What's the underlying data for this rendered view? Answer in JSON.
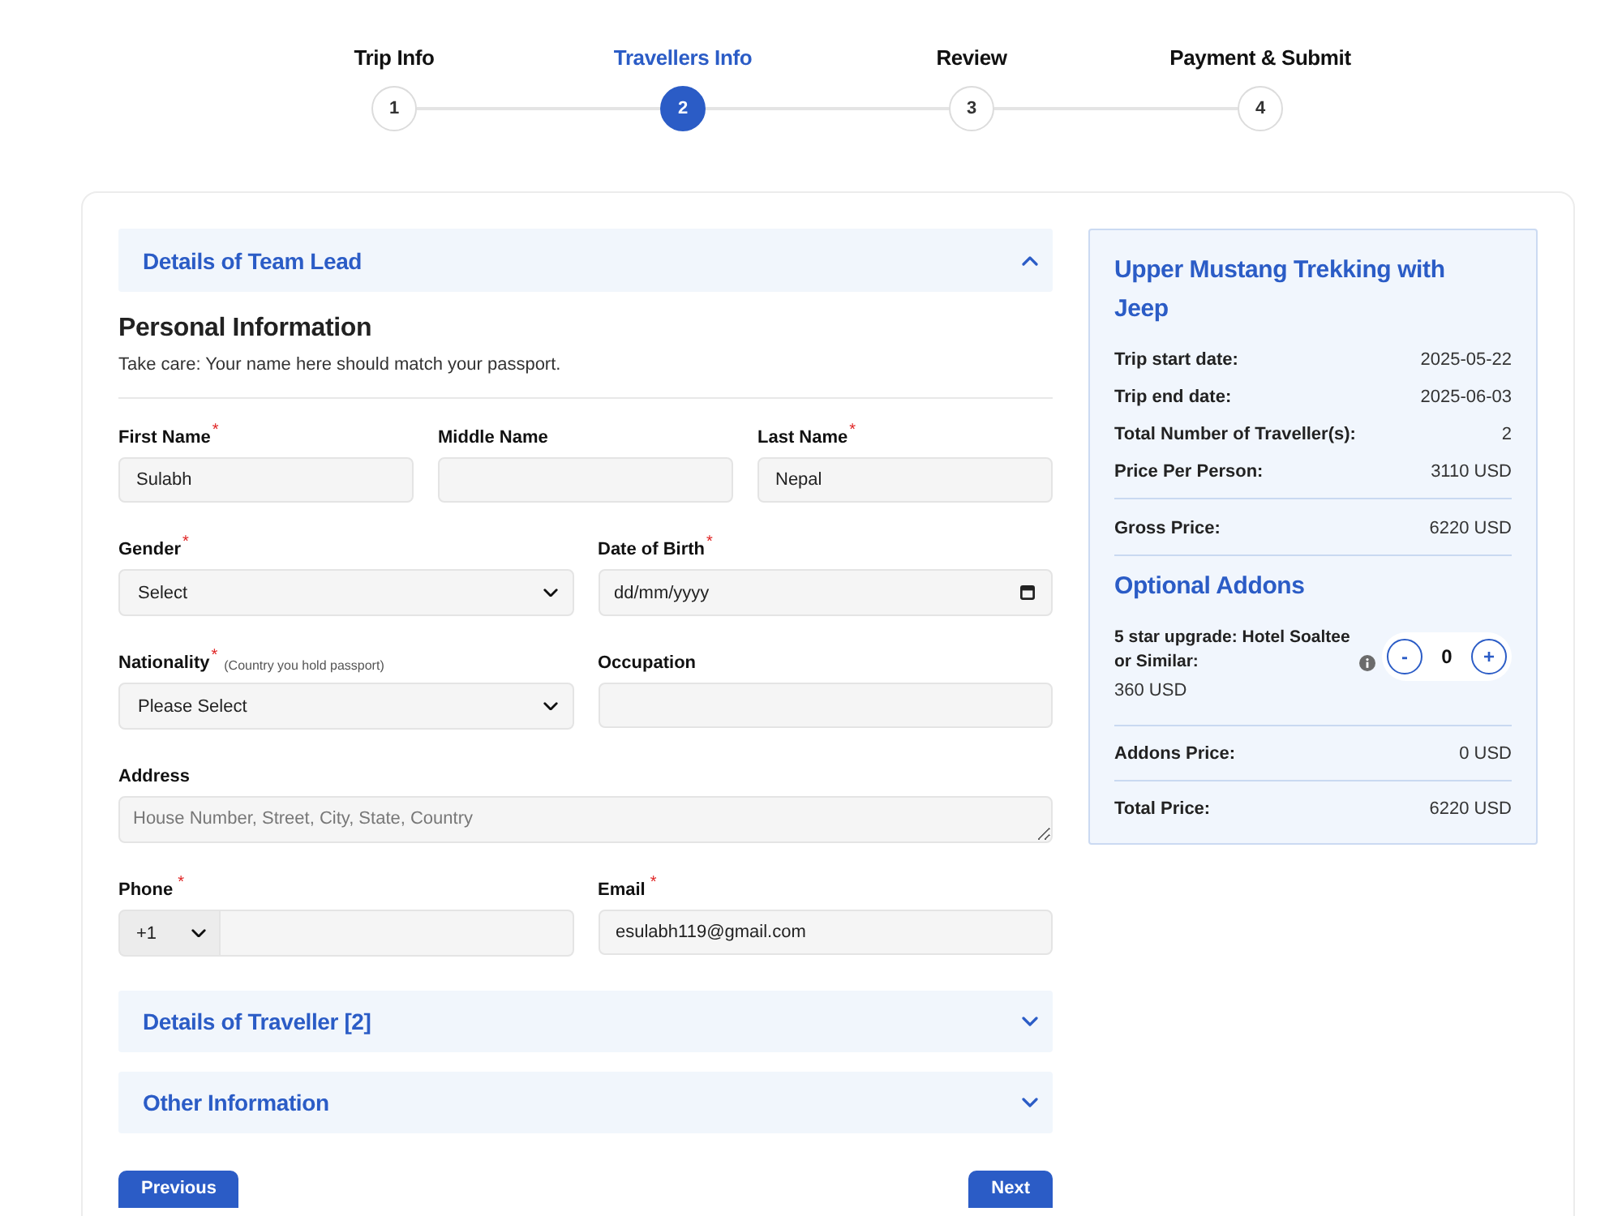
{
  "stepper": {
    "steps": [
      {
        "label": "Trip Info",
        "number": "1",
        "selected": false
      },
      {
        "label": "Travellers Info",
        "number": "2",
        "selected": true
      },
      {
        "label": "Review",
        "number": "3",
        "selected": false
      },
      {
        "label": "Payment & Submit",
        "number": "4",
        "selected": false
      }
    ]
  },
  "sections": [
    {
      "title": "Details of Team Lead",
      "expanded": true,
      "heading": "Personal Information",
      "note": "Take care: Your name here should match your passport.",
      "rows": [
        [
          {
            "kind": "text",
            "label": "First Name",
            "required_mark": "*",
            "value": "Sulabh"
          },
          {
            "kind": "text",
            "label": "Middle Name"
          },
          {
            "kind": "text",
            "label": "Last Name",
            "required_mark": "*",
            "value": "Nepal"
          }
        ],
        [
          {
            "kind": "select",
            "label": "Gender",
            "required_mark": "*",
            "value": "Select"
          },
          {
            "kind": "date",
            "label": "Date of Birth",
            "required_mark": "*",
            "placeholder": "dd/mm/yyyy"
          }
        ],
        [
          {
            "kind": "select",
            "label": "Nationality",
            "required_mark": "*",
            "hint": "(Country you hold passport)",
            "value": "Please Select"
          },
          {
            "kind": "text",
            "label": "Occupation"
          }
        ],
        [
          {
            "kind": "textarea",
            "label": "Address",
            "placeholder": "House Number, Street, City, State, Country"
          }
        ],
        [
          {
            "kind": "phone",
            "label": "Phone",
            "required_mark": "*",
            "code": "+1"
          },
          {
            "kind": "text",
            "label": "Email",
            "required_mark": "*",
            "value": "esulabh119@gmail.com"
          }
        ]
      ]
    },
    {
      "title": "Details of Traveller [2]",
      "expanded": false
    },
    {
      "title": "Other Information",
      "expanded": false
    }
  ],
  "buttons": [
    {
      "label": "Previous"
    },
    {
      "label": "Next"
    }
  ],
  "summary": {
    "title": "Upper Mustang Trekking with Jeep",
    "trip_rows": [
      {
        "label": "Trip start date:",
        "value": "2025-05-22"
      },
      {
        "label": "Trip end date:",
        "value": "2025-06-03"
      },
      {
        "label": "Total Number of Traveller(s):",
        "value": "2"
      },
      {
        "label": "Price Per Person:",
        "value": "3110 USD"
      }
    ],
    "gross": {
      "label": "Gross Price:",
      "value": "6220 USD"
    },
    "addons_title": "Optional Addons",
    "addons": [
      {
        "name": "5 star upgrade: Hotel Soaltee or Similar:",
        "price": "360 USD",
        "decrement": "-",
        "quantity": "0",
        "increment": "+"
      }
    ],
    "addons_price": {
      "label": "Addons Price:",
      "value": "0 USD"
    },
    "total": {
      "label": "Total Price:",
      "value": "6220 USD"
    }
  }
}
